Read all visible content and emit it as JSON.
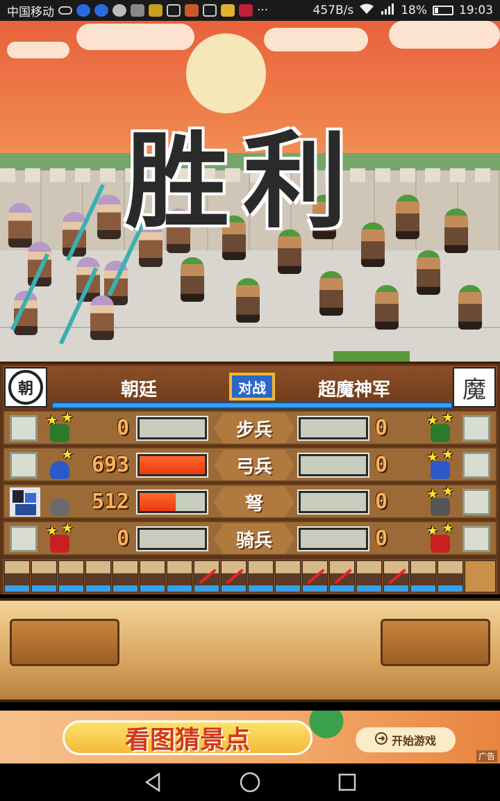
{
  "status_bar": {
    "carrier": "中国移动",
    "speed": "457B/s",
    "battery": "18%",
    "time": "19:03"
  },
  "scene": {
    "victory_text": "胜利"
  },
  "battle": {
    "team_left": "朝廷",
    "team_right": "超魔神军",
    "vs_label": "对战",
    "emblem_right": "魔",
    "rows": [
      {
        "type": "步兵",
        "left_value": "0",
        "right_value": "0",
        "left_fill": 0,
        "right_fill": 0
      },
      {
        "type": "弓兵",
        "left_value": "693",
        "right_value": "0",
        "left_fill": 1.0,
        "right_fill": 0
      },
      {
        "type": "弩",
        "left_value": "512",
        "right_value": "0",
        "left_fill": 0.55,
        "right_fill": 0
      },
      {
        "type": "骑兵",
        "left_value": "0",
        "right_value": "0",
        "left_fill": 0,
        "right_fill": 0
      }
    ]
  },
  "ad": {
    "title": "看图猜景点",
    "button": "开始游戏",
    "tag": "广告"
  },
  "colors": {
    "accent": "#f08850",
    "hp_fill": "#e83a12",
    "blue": "#39a0f0"
  }
}
